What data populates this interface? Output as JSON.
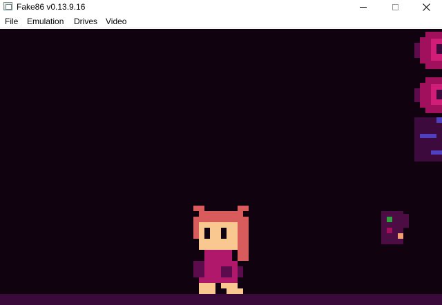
{
  "window": {
    "title": "Fake86 v0.13.9.16"
  },
  "menu": {
    "items": [
      "File",
      "Emulation",
      "Drives",
      "Video"
    ]
  },
  "icons": {
    "app": "app-window-icon",
    "minimize": "minimize-icon",
    "maximize": "maximize-icon",
    "close": "close-icon"
  },
  "colors": {
    "screen_background": "#10020f",
    "floor": "#3a0a3a",
    "wall_magenta": "#a0105c",
    "wall_dark": "#3c0a3c",
    "wall_blue": "#5040c0",
    "hair": "#d85c5c",
    "skin": "#f8c890",
    "eyes": "#10020f",
    "dress": "#b0186c",
    "dress_shadow": "#5c0c4c",
    "enemy": "#4c0c44",
    "enemy_green": "#30a040",
    "enemy_peach": "#f0a070"
  }
}
